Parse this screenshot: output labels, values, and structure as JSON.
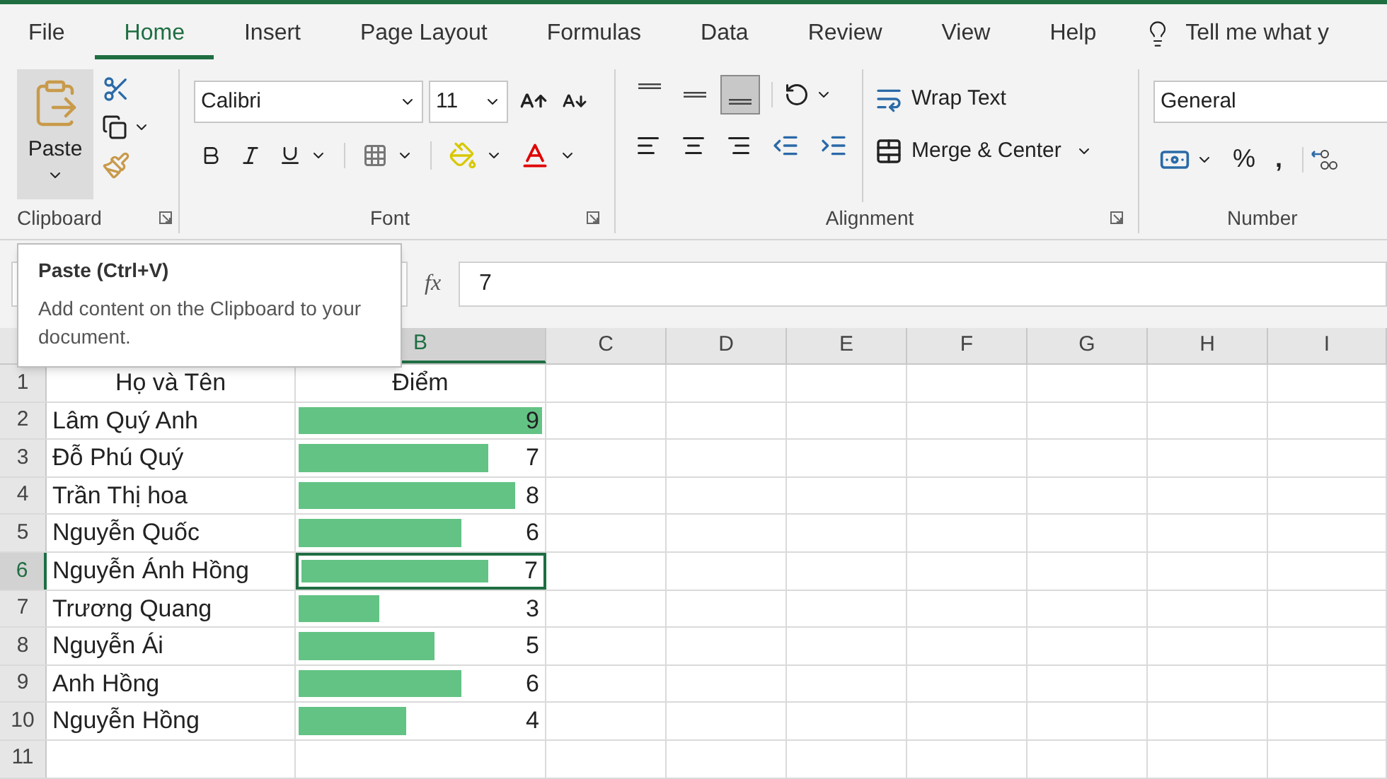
{
  "tabs": [
    {
      "label": "File",
      "selected": false
    },
    {
      "label": "Home",
      "selected": true
    },
    {
      "label": "Insert",
      "selected": false
    },
    {
      "label": "Page Layout",
      "selected": false
    },
    {
      "label": "Formulas",
      "selected": false
    },
    {
      "label": "Data",
      "selected": false
    },
    {
      "label": "Review",
      "selected": false
    },
    {
      "label": "View",
      "selected": false
    },
    {
      "label": "Help",
      "selected": false
    }
  ],
  "tell_me": {
    "placeholder": "Tell me what y"
  },
  "ribbon": {
    "clipboard": {
      "label": "Clipboard",
      "paste": "Paste"
    },
    "font": {
      "label": "Font",
      "name": "Calibri",
      "size": "11"
    },
    "alignment": {
      "label": "Alignment",
      "vertical": [
        {
          "kind": "top",
          "selected": false
        },
        {
          "kind": "middle",
          "selected": false
        },
        {
          "kind": "bottom",
          "selected": true
        }
      ],
      "wrap_text": "Wrap Text",
      "merge": "Merge & Center"
    },
    "number": {
      "label": "Number",
      "format": "General",
      "percent": "%",
      "comma": ","
    }
  },
  "tooltip": {
    "title": "Paste (Ctrl+V)",
    "text": "Add content on the Clipboard to your document."
  },
  "formula_bar": {
    "function_label": "fx",
    "value": "7"
  },
  "sheet": {
    "columns": [
      {
        "label": "B",
        "selected": true
      },
      {
        "label": "C",
        "selected": false
      },
      {
        "label": "D",
        "selected": false
      },
      {
        "label": "E",
        "selected": false
      },
      {
        "label": "F",
        "selected": false
      },
      {
        "label": "G",
        "selected": false
      },
      {
        "label": "H",
        "selected": false
      },
      {
        "label": "I",
        "selected": false
      }
    ],
    "rows": [
      {
        "number": "1",
        "kind": "header",
        "selected": false,
        "name": "Họ và Tên",
        "score": "Điểm"
      },
      {
        "number": "2",
        "kind": "data",
        "selected": false,
        "name": "Lâm Quý Anh",
        "score": "9",
        "level": 1
      },
      {
        "number": "3",
        "kind": "data",
        "selected": false,
        "name": "Đỗ Phú Quý",
        "score": "7",
        "level": 0.78
      },
      {
        "number": "4",
        "kind": "data",
        "selected": false,
        "name": "Trần Thị hoa",
        "score": "8",
        "level": 0.89
      },
      {
        "number": "5",
        "kind": "data",
        "selected": false,
        "name": "Nguyễn Quốc",
        "score": "6",
        "level": 0.67
      },
      {
        "number": "6",
        "kind": "data",
        "selected": true,
        "name": "Nguyễn Ánh Hồng",
        "score": "7",
        "level": 0.78
      },
      {
        "number": "7",
        "kind": "data",
        "selected": false,
        "name": "Trương Quang",
        "score": "3",
        "level": 0.33
      },
      {
        "number": "8",
        "kind": "data",
        "selected": false,
        "name": "Nguyễn Ái",
        "score": "5",
        "level": 0.56
      },
      {
        "number": "9",
        "kind": "data",
        "selected": false,
        "name": "Anh Hồng",
        "score": "6",
        "level": 0.67
      },
      {
        "number": "10",
        "kind": "data",
        "selected": false,
        "name": "Nguyễn Hồng",
        "score": "4",
        "level": 0.44
      },
      {
        "number": "11",
        "kind": "empty",
        "selected": false
      }
    ]
  }
}
